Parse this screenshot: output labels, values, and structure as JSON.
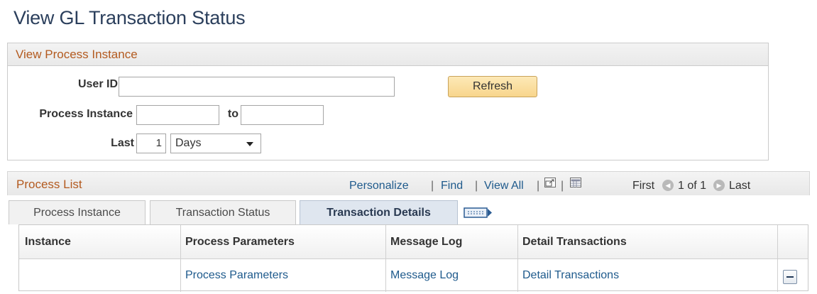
{
  "page_title": "View GL Transaction Status",
  "group": {
    "title": "View Process Instance",
    "user_id_label": "User ID",
    "user_id_value": "",
    "refresh_label": "Refresh",
    "process_instance_label": "Process Instance",
    "process_instance_from": "",
    "to_label": "to",
    "process_instance_to": "",
    "last_label": "Last",
    "last_value": "1",
    "period_selected": "Days"
  },
  "process_list": {
    "title": "Process List",
    "personalize": "Personalize",
    "find": "Find",
    "view_all": "View All",
    "sep": "|",
    "first": "First",
    "page_status": "1 of 1",
    "last": "Last"
  },
  "tabs": [
    {
      "label": "Process Instance"
    },
    {
      "label": "Transaction Status"
    },
    {
      "label": "Transaction Details"
    }
  ],
  "grid": {
    "columns": [
      "Instance",
      "Process Parameters",
      "Message Log",
      "Detail Transactions"
    ],
    "rows": [
      {
        "instance": "",
        "process_parameters": "Process Parameters",
        "message_log": "Message Log",
        "detail_transactions": "Detail Transactions"
      }
    ]
  },
  "icons": {
    "new_window": "new-window-icon",
    "download": "download-grid-icon",
    "prev": "previous-arrow-icon",
    "next": "next-arrow-icon",
    "show_all_columns": "show-all-columns-icon",
    "delete_row": "delete-row-icon"
  },
  "colors": {
    "title": "#2b3f5c",
    "section_title": "#b35a1f",
    "link": "#1e5a8c",
    "button_bg": "#f8d58c"
  }
}
